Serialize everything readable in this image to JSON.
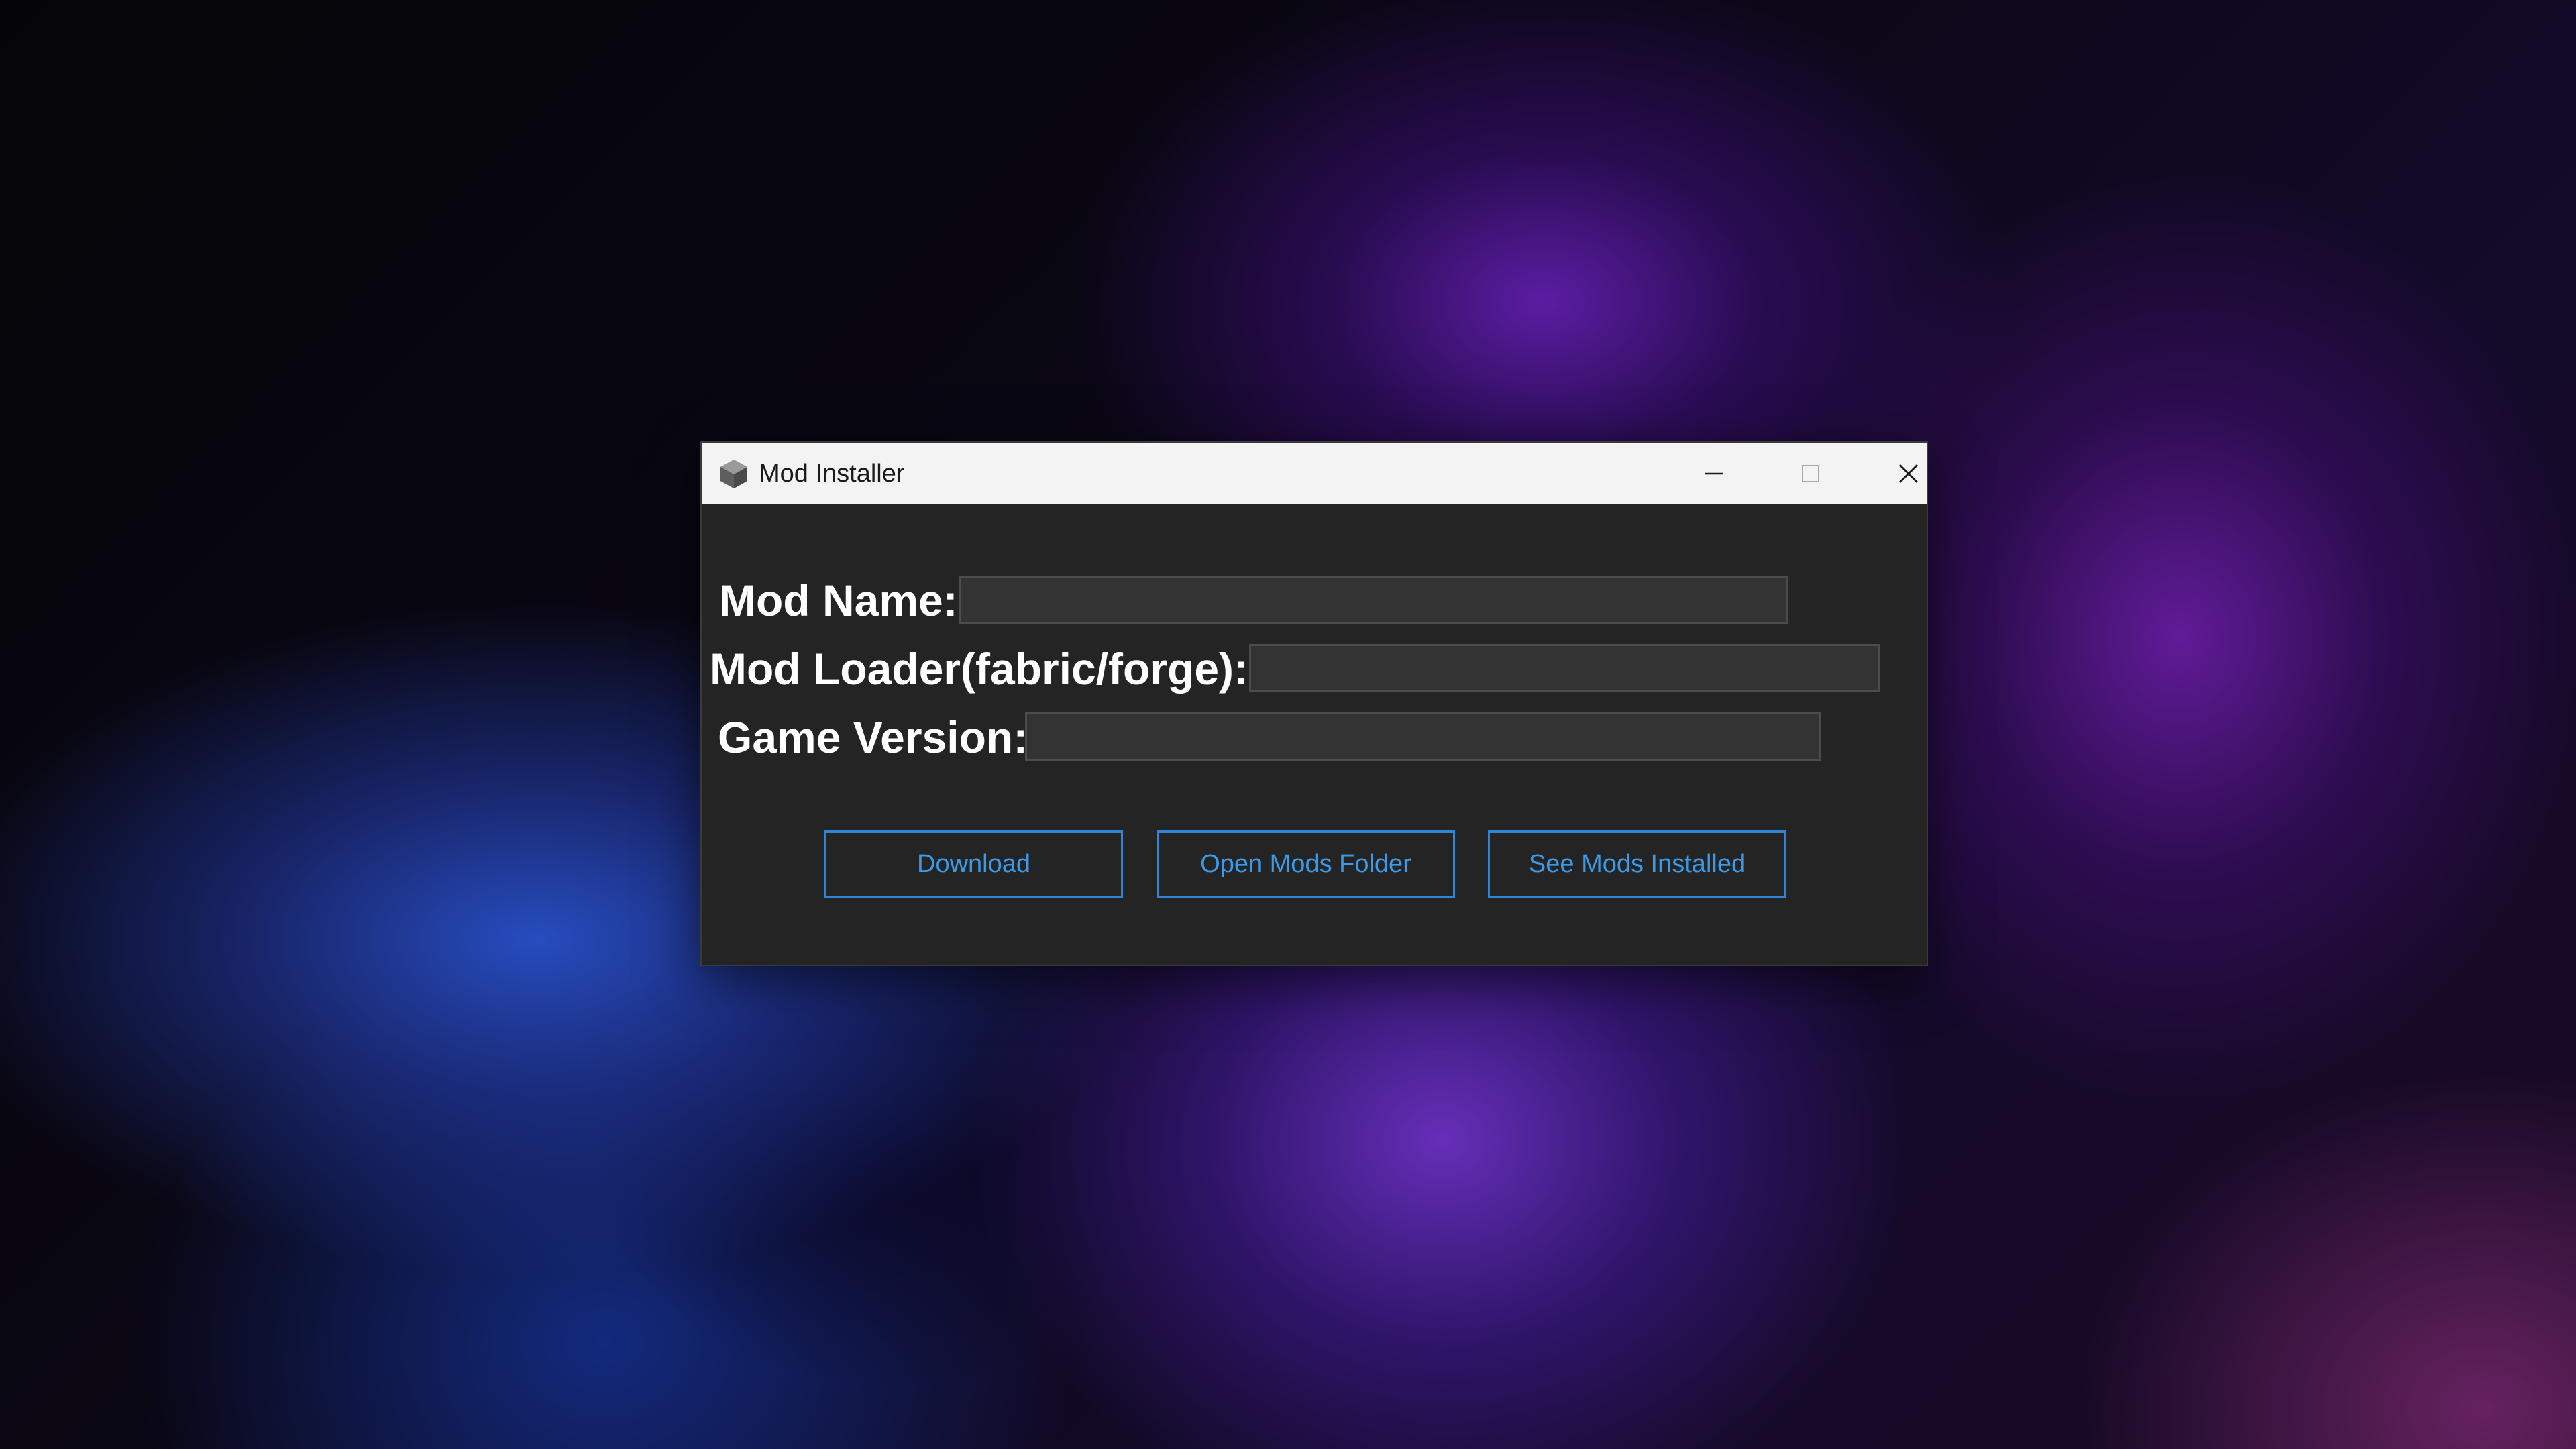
{
  "window": {
    "title": "Mod Installer",
    "icon": "cube-icon"
  },
  "titlebar_buttons": [
    "minimize-icon",
    "maximize-icon",
    "close-icon"
  ],
  "form": {
    "mod_name": {
      "label": "Mod Name:",
      "value": ""
    },
    "mod_loader": {
      "label": "Mod Loader(fabric/forge):",
      "value": ""
    },
    "game_version": {
      "label": "Game Version:",
      "value": ""
    }
  },
  "buttons": {
    "download": "Download",
    "open_folder": "Open Mods Folder",
    "see_installed": "See Mods Installed"
  },
  "colors": {
    "window_bg": "#242424",
    "titlebar_bg": "#f3f3f3",
    "accent": "#3b9be8",
    "label": "#ffffff"
  }
}
